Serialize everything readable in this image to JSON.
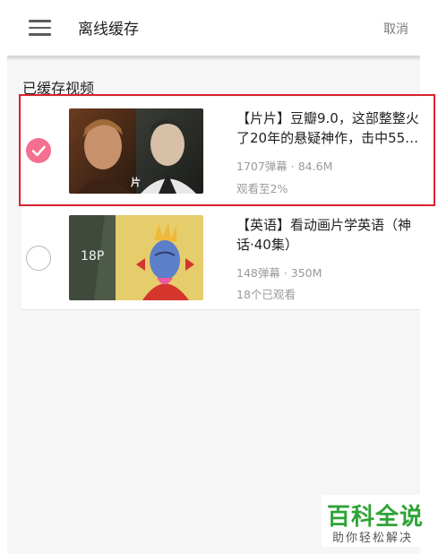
{
  "header": {
    "menu_icon": "hamburger-menu-icon",
    "title": "离线缓存",
    "cancel_label": "取消"
  },
  "section": {
    "title": "已缓存视频"
  },
  "items": [
    {
      "title_line1": "【片片】豆瓣9.0，这部整整火",
      "title_line2": "了20年的悬疑神作，击中55…",
      "danmaku_size": "1707弹幕 · 84.6M",
      "progress": "观看至2%",
      "checked": true,
      "thumb_badge": ""
    },
    {
      "title_line1": "【英语】看动画片学英语（神",
      "title_line2": "话·40集）",
      "danmaku_size": "148弹幕 · 350M",
      "progress": "18个已观看",
      "checked": false,
      "thumb_badge": "18P"
    }
  ],
  "watermark": {
    "main": "百科全说",
    "sub": "助你轻松解决"
  },
  "colors": {
    "accent_pink": "#f46f90",
    "highlight_red": "#d9232e",
    "watermark_green": "#2fa336"
  }
}
